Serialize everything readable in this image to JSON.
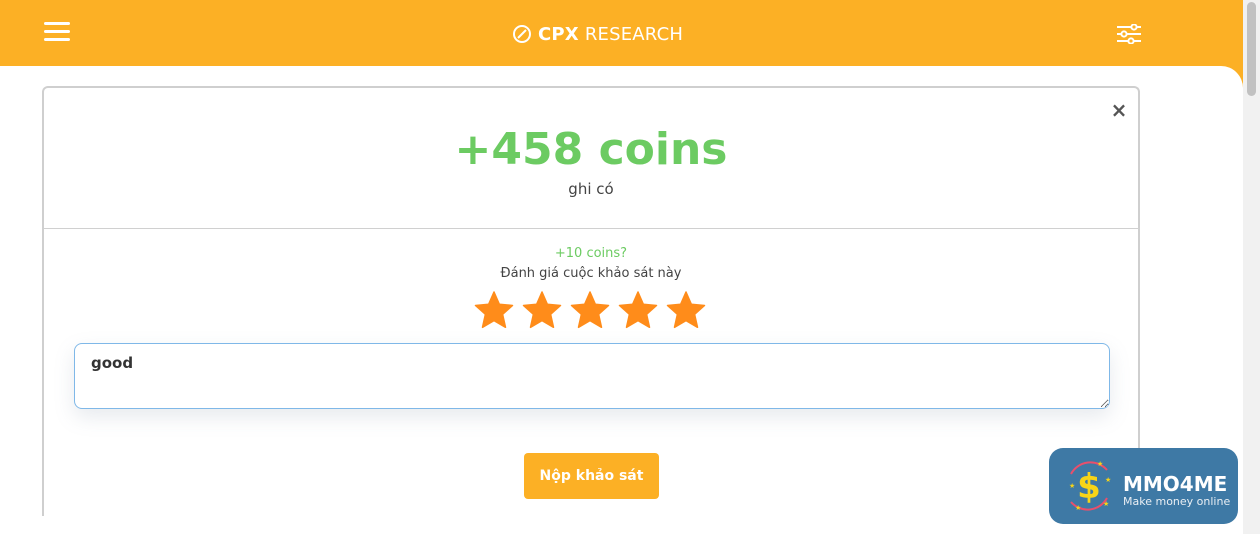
{
  "header": {
    "logo_bold": "CPX",
    "logo_light": "RESEARCH",
    "menu_icon": "hamburger-menu-icon",
    "settings_icon": "sliders-icon",
    "color": "#fcb025"
  },
  "modal": {
    "close_label": "×",
    "coins": "+458 coins",
    "credited": "ghi có",
    "bonus": "+10 coins?",
    "rate_prompt": "Đánh giá cuộc khảo sát này",
    "rating": 5,
    "rating_max": 5,
    "feedback_value": "good",
    "submit_label": "Nộp khảo sát",
    "accent_green": "#6ccb62",
    "star_color": "#ff8c1a"
  },
  "watermark": {
    "title": "MMO4ME",
    "subtitle": "Make money online",
    "bg_color": "#3e79a5"
  }
}
